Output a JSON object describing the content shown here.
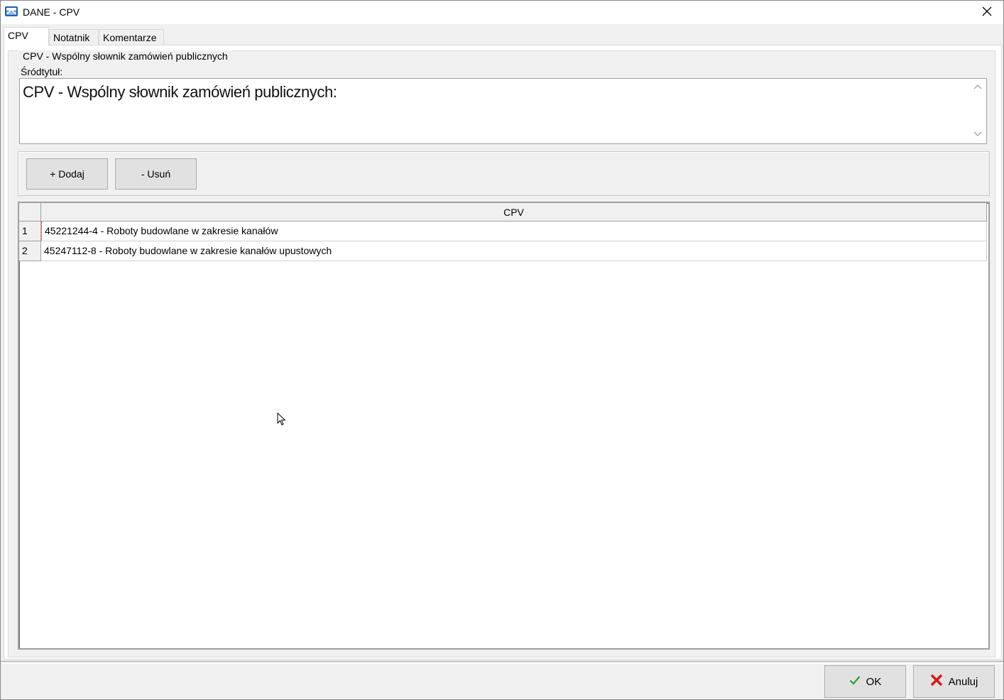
{
  "window": {
    "title": "DANE - CPV"
  },
  "tabs": [
    {
      "label": "CPV",
      "active": true
    },
    {
      "label": "Notatnik",
      "active": false
    },
    {
      "label": "Komentarze",
      "active": false
    }
  ],
  "group": {
    "legend": "CPV - Wspólny słownik zamówień publicznych",
    "subtitle_label": "Śródtytuł:",
    "subtitle_value": "CPV - Wspólny słownik zamówień publicznych:"
  },
  "toolbar": {
    "add_label": "+ Dodaj",
    "remove_label": "- Usuń"
  },
  "grid": {
    "column_header": "CPV",
    "rows": [
      {
        "num": "1",
        "value": "45221244-4 - Roboty budowlane w zakresie kanałów"
      },
      {
        "num": "2",
        "value": "45247112-8 - Roboty budowlane w zakresie kanałów upustowych"
      }
    ]
  },
  "footer": {
    "ok_label": "OK",
    "cancel_label": "Anuluj"
  },
  "colors": {
    "ok_check": "#2e9e2e",
    "cancel_x": "#d21a1a"
  },
  "icons": {
    "app": "app-icon",
    "close": "close-icon",
    "ok": "checkmark-icon",
    "cancel": "x-icon"
  }
}
